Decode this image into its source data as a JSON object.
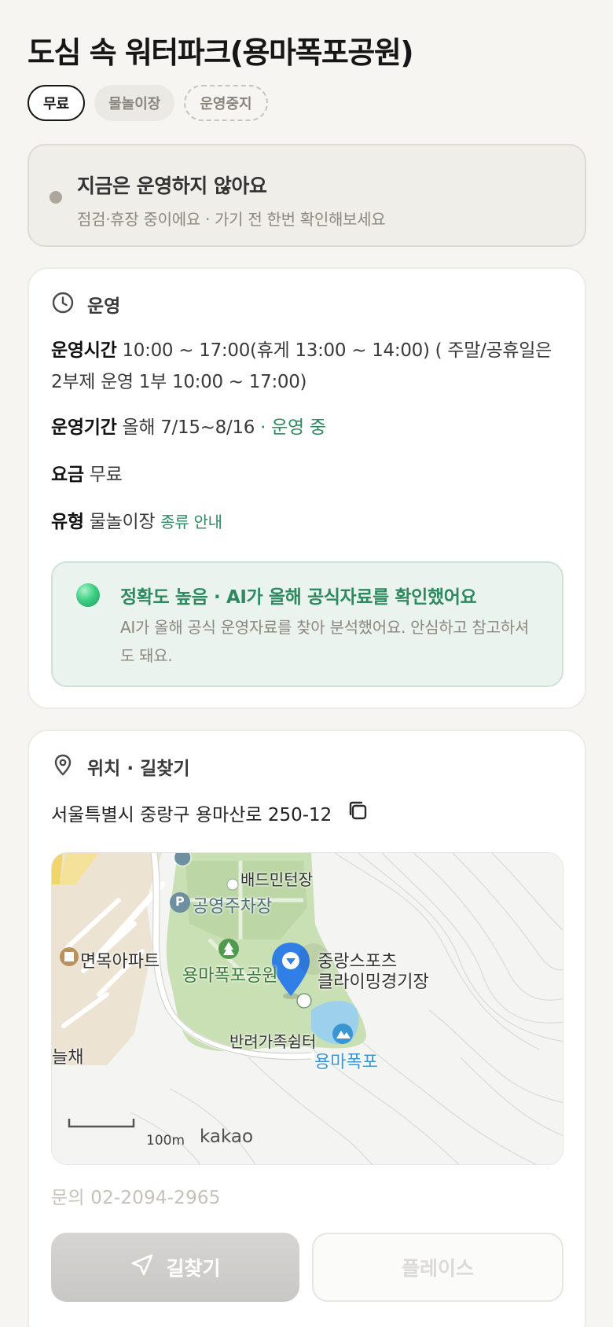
{
  "title": "도심 속 워터파크(용마폭포공원)",
  "tags": [
    "무료",
    "물놀이장",
    "운영중지"
  ],
  "status": {
    "title": "지금은 운영하지 않아요",
    "subtitle": "점검·휴장 중이에요 · 가기 전 한번 확인해보세요"
  },
  "operation": {
    "section_title": "운영",
    "hours_label": "운영시간",
    "hours_value": "10:00 ~ 17:00(휴게 13:00 ~ 14:00) ( 주말/공휴일은 2부제 운영 1부 10:00 ~ 17:00)",
    "period_label": "운영기간",
    "period_value": "올해 7/15~8/16",
    "period_status": "· 운영 중",
    "fee_label": "요금",
    "fee_value": "무료",
    "type_label": "유형",
    "type_value": "물놀이장",
    "type_link": "종류 안내",
    "ai_title": "정확도 높음 · AI가 올해 공식자료를 확인했어요",
    "ai_text": "AI가 올해 공식 운영자료를 찾아 분석했어요. 안심하고 참고하셔도 돼요."
  },
  "location": {
    "section_title": "위치 · 길찾기",
    "address": "서울특별시 중랑구 용마산로 250-12",
    "map": {
      "labels": {
        "badminton": "배드민턴장",
        "parking": "공영주차장",
        "apartment": "면목아파트",
        "park": "용마폭포공원",
        "sports1": "중랑스포츠",
        "sports2": "클라이밍경기장",
        "pet": "반려가족쉼터",
        "falls": "용마폭포",
        "left_edge": "늘채",
        "scale": "100m",
        "brand": "kakao",
        "parking_badge": "P"
      }
    },
    "contact": "문의 02-2094-2965",
    "route_button": "길찾기",
    "place_button": "플레이스"
  }
}
